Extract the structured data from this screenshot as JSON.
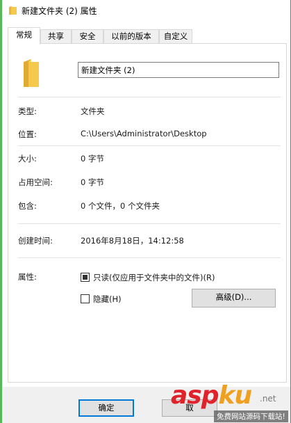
{
  "window": {
    "title": "新建文件夹 (2) 属性"
  },
  "tabs": [
    {
      "label": "常规",
      "active": true
    },
    {
      "label": "共享",
      "active": false
    },
    {
      "label": "安全",
      "active": false
    },
    {
      "label": "以前的版本",
      "active": false
    },
    {
      "label": "自定义",
      "active": false
    }
  ],
  "general": {
    "folder_name": "新建文件夹 (2)",
    "type_label": "类型:",
    "type_value": "文件夹",
    "location_label": "位置:",
    "location_value": "C:\\Users\\Administrator\\Desktop",
    "size_label": "大小:",
    "size_value": "0 字节",
    "size_on_disk_label": "占用空间:",
    "size_on_disk_value": "0 字节",
    "contains_label": "包含:",
    "contains_value": "0 个文件，0 个文件夹",
    "created_label": "创建时间:",
    "created_value": "2016年8月18日，14:12:58",
    "attributes_label": "属性:",
    "readonly_label": "只读(仅应用于文件夹中的文件)(R)",
    "readonly_checked": true,
    "hidden_label": "隐藏(H)",
    "hidden_checked": false,
    "advanced_button": "高级(D)..."
  },
  "footer": {
    "ok_button": "确定",
    "cancel_button_partial": "取"
  },
  "watermark": {
    "asp": "asp",
    "ku": "ku",
    "net": ".net",
    "sub": "免费网站源码下载站!"
  },
  "colors": {
    "folder_yellow": "#f4c94c",
    "accent": "#0078d7",
    "watermark_red": "#e0232b",
    "watermark_orange": "#f0a020"
  },
  "icons": {
    "title_icon": "folder-icon",
    "large_icon": "folder-icon"
  }
}
